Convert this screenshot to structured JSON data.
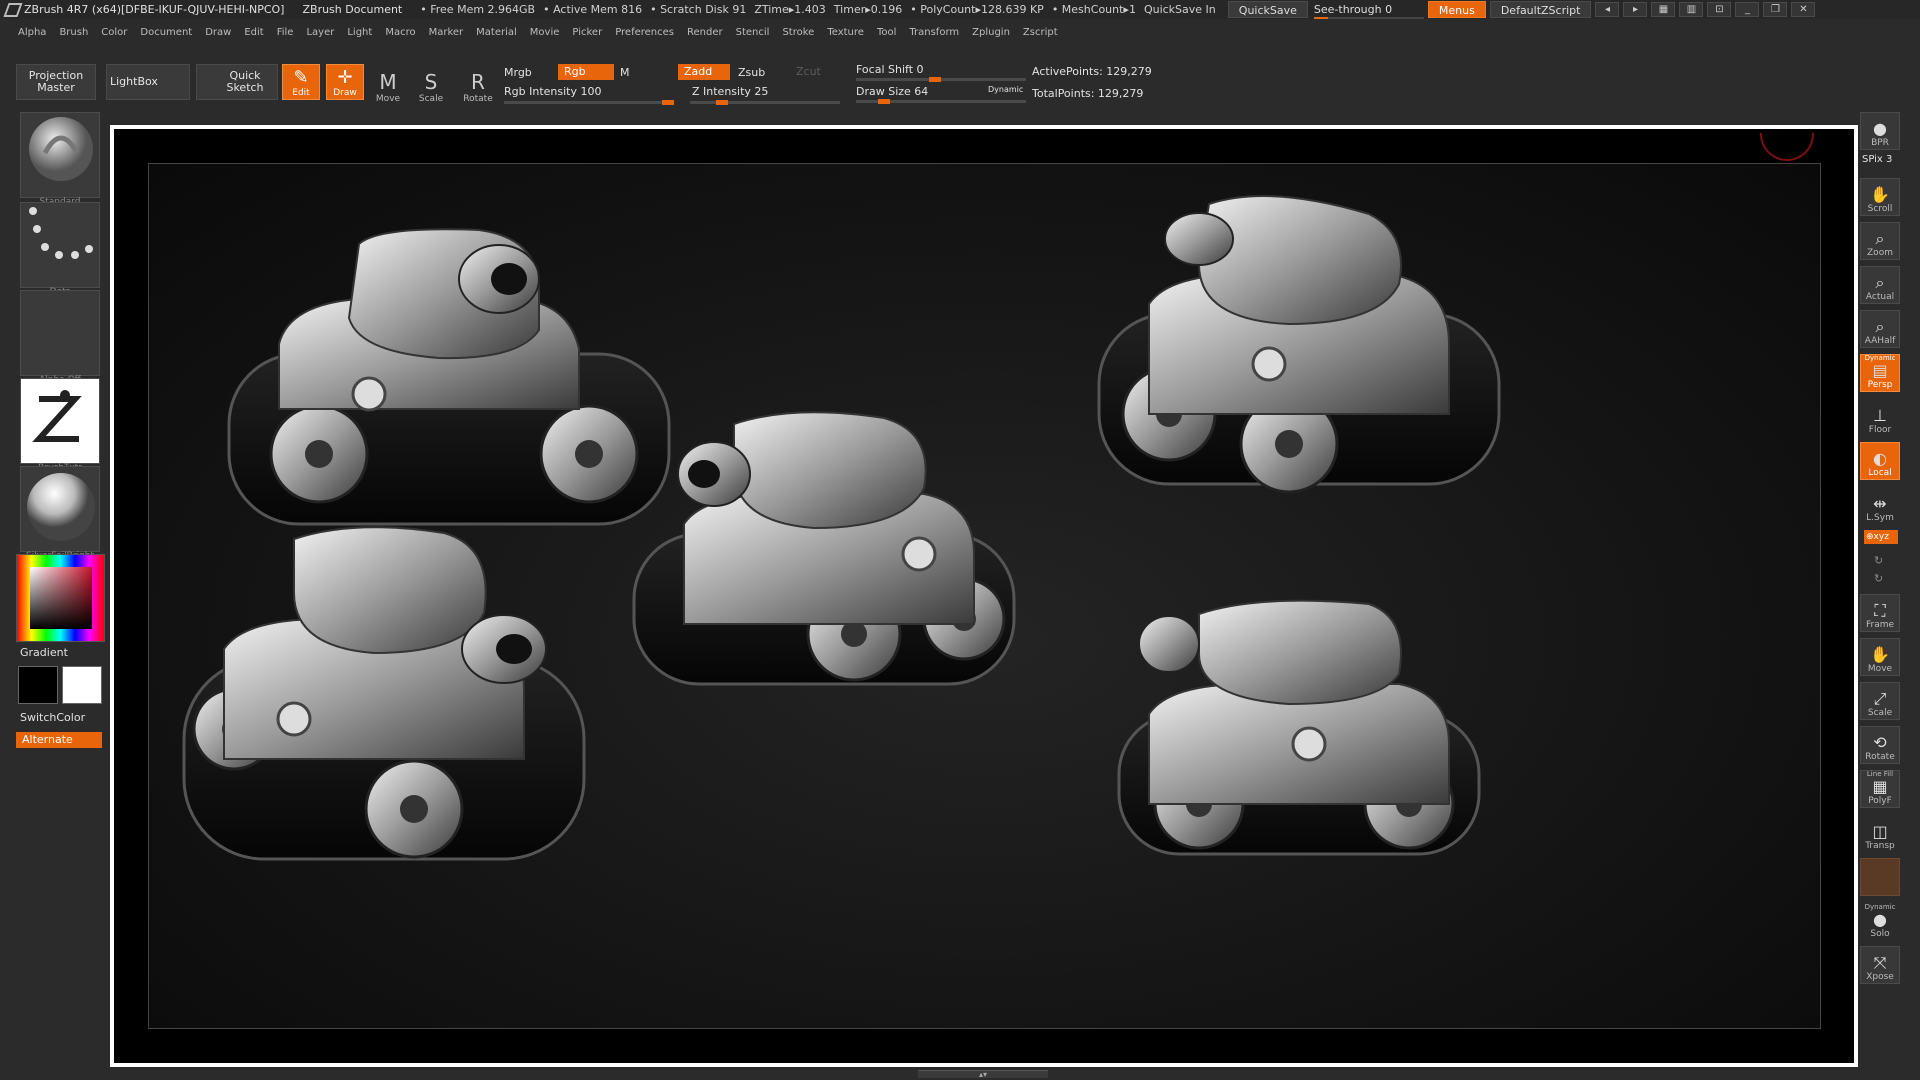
{
  "title": {
    "app": "ZBrush 4R7 (x64)[DFBE-IKUF-QJUV-HEHI-NPCO]",
    "doc": "ZBrush Document",
    "free_mem": "• Free Mem 2.964GB",
    "active_mem": "• Active Mem 816",
    "scratch": "• Scratch Disk 91",
    "ztime": "ZTime▸1.403",
    "timer": "Timer▸0.196",
    "polycount": "• PolyCount▸128.639 KP",
    "meshcount": "• MeshCount▸1",
    "quicksave_label": "QuickSave In",
    "quicksave_btn": "QuickSave",
    "seethrough": "See-through  0",
    "menus": "Menus",
    "script": "DefaultZScript"
  },
  "menu": [
    "Alpha",
    "Brush",
    "Color",
    "Document",
    "Draw",
    "Edit",
    "File",
    "Layer",
    "Light",
    "Macro",
    "Marker",
    "Material",
    "Movie",
    "Picker",
    "Preferences",
    "Render",
    "Stencil",
    "Stroke",
    "Texture",
    "Tool",
    "Transform",
    "Zplugin",
    "Zscript"
  ],
  "shelf": {
    "projection_master": "Projection Master",
    "lightbox": "LightBox",
    "quick_sketch": "Quick Sketch",
    "edit": "Edit",
    "draw": "Draw",
    "move": "Move",
    "scale": "Scale",
    "rotate": "Rotate",
    "mrgb": "Mrgb",
    "rgb": "Rgb",
    "m": "M",
    "rgb_intensity": "Rgb Intensity 100",
    "zadd": "Zadd",
    "zsub": "Zsub",
    "zcut": "Zcut",
    "z_intensity": "Z Intensity 25",
    "focal_shift": "Focal Shift 0",
    "draw_size": "Draw Size 64",
    "dynamic": "Dynamic",
    "active_points": "ActivePoints: 129,279",
    "total_points": "TotalPoints: 129,279",
    "rgb_intensity_value": 1.0,
    "z_intensity_value": 0.25,
    "focal_shift_value": 0.5,
    "draw_size_value": 0.2
  },
  "left": {
    "brush": "Standard",
    "stroke": "Dots",
    "alpha": "Alpha  Off",
    "texture": "BrushTxtr",
    "material": "SilverFoilBright",
    "gradient": "Gradient",
    "switchcolor": "SwitchColor",
    "alternate": "Alternate"
  },
  "right": {
    "bpr": "BPR",
    "spix": "SPix 3",
    "scroll": "Scroll",
    "zoom": "Zoom",
    "actual": "Actual",
    "aahalf": "AAHalf",
    "dynamic": "Dynamic",
    "persp": "Persp",
    "floor": "Floor",
    "local": "Local",
    "lsym": "L.Sym",
    "xyz": "⊕xyz",
    "frame": "Frame",
    "move": "Move",
    "scale": "Scale",
    "rotate": "Rotate",
    "linefill": "Line Fill",
    "polyf": "PolyF",
    "transp": "Transp",
    "dynamic2": "Dynamic",
    "solo": "Solo",
    "xpose": "Xpose"
  },
  "colors": {
    "accent": "#e8650c",
    "panel": "#2b2b2b",
    "button": "#3a3a3a"
  }
}
